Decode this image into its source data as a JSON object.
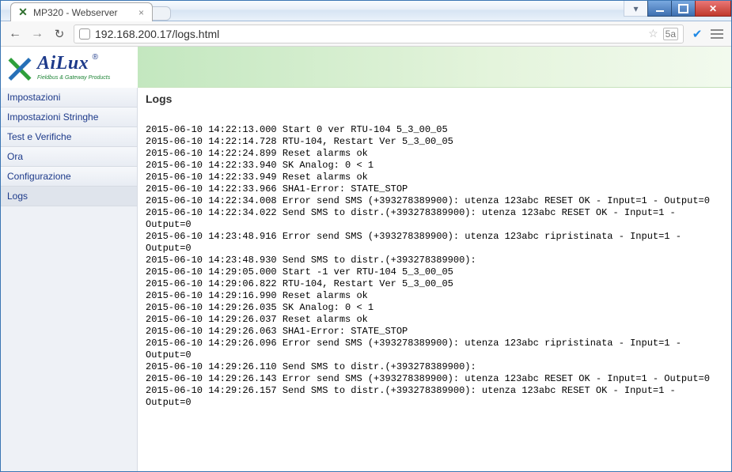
{
  "window": {
    "tab_title": "MP320 - Webserver",
    "url": "192.168.200.17/logs.html"
  },
  "logo": {
    "brand": "AiLux",
    "reg": "®",
    "tagline": "Fieldbus & Gateway Products"
  },
  "sidebar": {
    "items": [
      {
        "label": "Impostazioni"
      },
      {
        "label": "Impostazioni Stringhe"
      },
      {
        "label": "Test e Verifiche"
      },
      {
        "label": "Ora"
      },
      {
        "label": "Configurazione"
      },
      {
        "label": "Logs"
      }
    ],
    "selected_index": 5
  },
  "page": {
    "title": "Logs",
    "log_text": "2015-06-10 14:22:13.000 Start 0 ver RTU-104 5_3_00_05\n2015-06-10 14:22:14.728 RTU-104, Restart Ver 5_3_00_05\n2015-06-10 14:22:24.899 Reset alarms ok\n2015-06-10 14:22:33.940 SK Analog: 0 < 1\n2015-06-10 14:22:33.949 Reset alarms ok\n2015-06-10 14:22:33.966 SHA1-Error: STATE_STOP\n2015-06-10 14:22:34.008 Error send SMS (+393278389900): utenza 123abc RESET OK - Input=1 - Output=0\n2015-06-10 14:22:34.022 Send SMS to distr.(+393278389900): utenza 123abc RESET OK - Input=1 - Output=0\n2015-06-10 14:23:48.916 Error send SMS (+393278389900): utenza 123abc ripristinata - Input=1 - Output=0\n2015-06-10 14:23:48.930 Send SMS to distr.(+393278389900):\n2015-06-10 14:29:05.000 Start -1 ver RTU-104 5_3_00_05\n2015-06-10 14:29:06.822 RTU-104, Restart Ver 5_3_00_05\n2015-06-10 14:29:16.990 Reset alarms ok\n2015-06-10 14:29:26.035 SK Analog: 0 < 1\n2015-06-10 14:29:26.037 Reset alarms ok\n2015-06-10 14:29:26.063 SHA1-Error: STATE_STOP\n2015-06-10 14:29:26.096 Error send SMS (+393278389900): utenza 123abc ripristinata - Input=1 - Output=0\n2015-06-10 14:29:26.110 Send SMS to distr.(+393278389900):\n2015-06-10 14:29:26.143 Error send SMS (+393278389900): utenza 123abc RESET OK - Input=1 - Output=0\n2015-06-10 14:29:26.157 Send SMS to distr.(+393278389900): utenza 123abc RESET OK - Input=1 - Output=0"
  }
}
